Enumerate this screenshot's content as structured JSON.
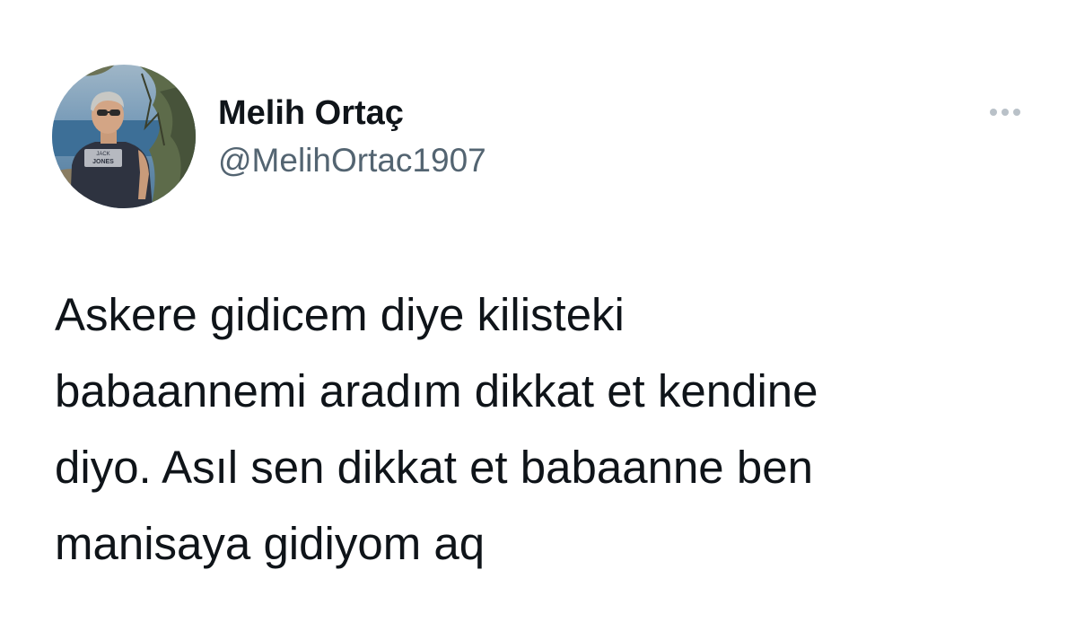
{
  "author": {
    "display_name": "Melih Ortaç",
    "handle": "@MelihOrtac1907",
    "avatar_shirt_text_1": "JACK",
    "avatar_shirt_text_2": "JONES"
  },
  "tweet": {
    "lines": [
      "Askere gidicem diye kilisteki",
      "babaannemi aradım dikkat et kendine",
      "diyo. Asıl sen dikkat et babaanne ben",
      "manisaya gidiyom aq"
    ]
  },
  "icons": {
    "more": "more-horizontal-icon"
  },
  "colors": {
    "text": "#0f1419",
    "secondary_text": "#536471",
    "more_icon": "#b9c1c8",
    "background": "#ffffff"
  }
}
